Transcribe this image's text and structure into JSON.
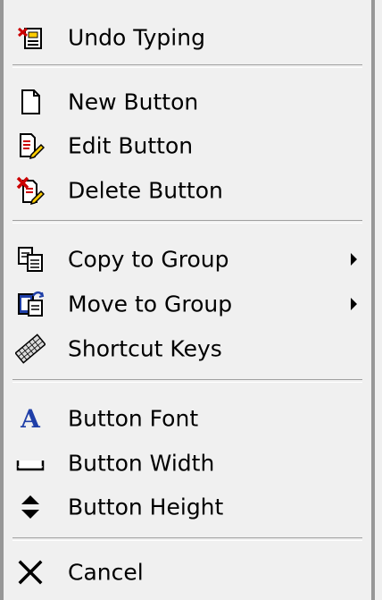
{
  "menu": {
    "undo": {
      "label": "Undo Typing",
      "icon": "undo-icon"
    },
    "new_button": {
      "label": "New Button",
      "icon": "new-document-icon"
    },
    "edit_button": {
      "label": "Edit Button",
      "icon": "edit-document-icon"
    },
    "delete_button": {
      "label": "Delete Button",
      "icon": "delete-document-icon"
    },
    "copy_to_group": {
      "label": "Copy to Group",
      "icon": "copy-icon"
    },
    "move_to_group": {
      "label": "Move to Group",
      "icon": "move-icon"
    },
    "shortcut_keys": {
      "label": "Shortcut Keys",
      "icon": "keyboard-icon"
    },
    "button_font": {
      "label": "Button Font",
      "icon": "font-icon"
    },
    "button_width": {
      "label": "Button Width",
      "icon": "width-icon"
    },
    "button_height": {
      "label": "Button Height",
      "icon": "height-icon"
    },
    "cancel": {
      "label": "Cancel",
      "icon": "close-icon"
    }
  },
  "colors": {
    "background": "#f0f0f0",
    "border": "#979797",
    "accent_red": "#cc0000",
    "accent_yellow": "#ffcc00",
    "accent_blue": "#1f3fa8"
  }
}
